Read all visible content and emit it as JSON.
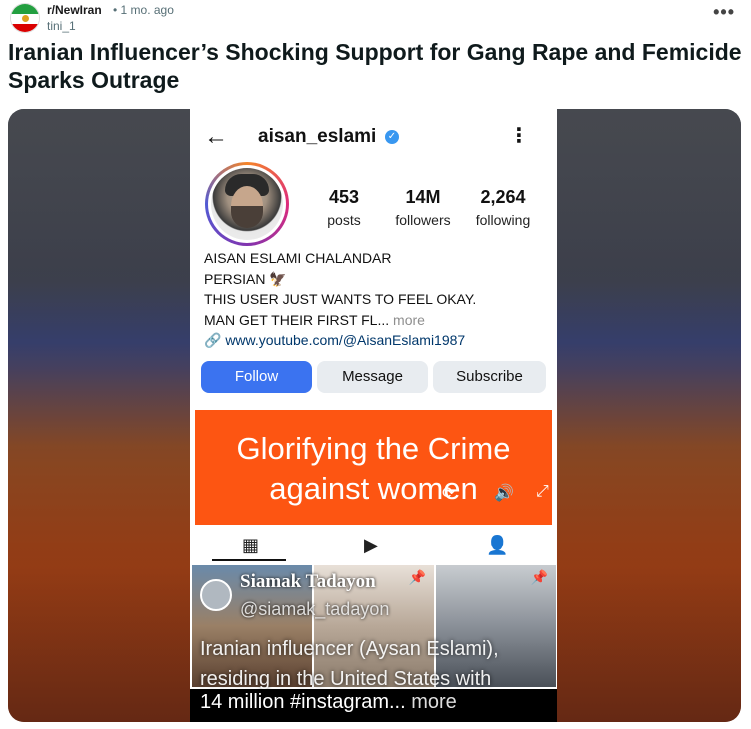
{
  "post": {
    "subreddit": "r/NewIran",
    "time": "• 1 mo. ago",
    "author": "tini_1",
    "more_menu": "•••",
    "title": "Iranian Influencer’s Shocking Support for Gang Rape and Femicide Sparks Outrage"
  },
  "instagram": {
    "back_icon": "←",
    "username": "aisan_eslami",
    "verified_icon": "✓",
    "menu_icon": "⋮",
    "stats": [
      {
        "value": "453",
        "label": "posts"
      },
      {
        "value": "14M",
        "label": "followers"
      },
      {
        "value": "2,264",
        "label": "following"
      }
    ],
    "bio": {
      "name": "AISAN ESLAMI CHALANDAR",
      "line1": "PERSIAN 🦅",
      "line2": "THIS USER JUST WANTS TO FEEL OKAY.",
      "line3": "MAN GET THEIR FIRST FL...",
      "more": "more",
      "link": "🔗 www.youtube.com/@AisanEslami1987"
    },
    "buttons": {
      "follow": "Follow",
      "message": "Message",
      "subscribe": "Subscribe"
    },
    "tabs": {
      "grid_icon": "▦",
      "reels_icon": "▶",
      "tagged_icon": "👤"
    }
  },
  "overlay": {
    "banner_line1": "Glorifying  the Crime",
    "banner_line2": "against women",
    "controls": {
      "a": "⟳",
      "b": "🔊",
      "c": "⤢"
    },
    "tweet_name": "Siamak Tadayon",
    "tweet_handle": "@siamak_tadayon",
    "pin_icon": "📌",
    "caption_lines": "Iranian influencer (Aysan Eslami), residing in the United States with",
    "caption_last": "14 million #instagram...",
    "caption_more": "more"
  },
  "colors": {
    "follow_button": "#3b73f0",
    "banner": "#fd5512",
    "verified": "#3897f0"
  }
}
